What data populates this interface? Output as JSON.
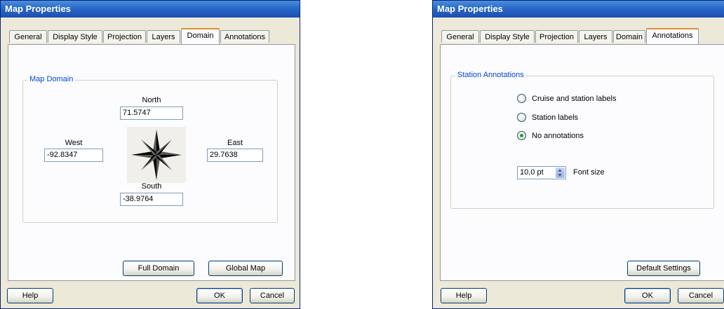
{
  "left_dialog": {
    "title": "Map Properties",
    "tabs": [
      "General",
      "Display Style",
      "Projection",
      "Layers",
      "Domain",
      "Annotations"
    ],
    "active_tab": "Domain",
    "group_title": "Map Domain",
    "north": {
      "label": "North",
      "value": "71.5747"
    },
    "west": {
      "label": "West",
      "value": "-92.8347"
    },
    "east": {
      "label": "East",
      "value": "29.7638"
    },
    "south": {
      "label": "South",
      "value": "-38.9764"
    },
    "full_domain_label": "Full Domain",
    "global_map_label": "Global Map",
    "help_label": "Help",
    "ok_label": "OK",
    "cancel_label": "Cancel"
  },
  "right_dialog": {
    "title": "Map Properties",
    "tabs": [
      "General",
      "Display Style",
      "Projection",
      "Layers",
      "Domain",
      "Annotations"
    ],
    "active_tab": "Annotations",
    "group_title": "Station Annotations",
    "options": [
      {
        "label": "Cruise and station labels",
        "selected": false
      },
      {
        "label": "Station labels",
        "selected": false
      },
      {
        "label": "No annotations",
        "selected": true
      }
    ],
    "font_size_value": "10,0 pt",
    "font_size_label": "Font size",
    "default_settings_label": "Default Settings",
    "help_label": "Help",
    "ok_label": "OK",
    "cancel_label": "Cancel"
  },
  "colors": {
    "title_bar": "#2968c8",
    "group_legend": "#0046d5",
    "active_tab_accent": "#e68b2c",
    "radio_selected": "#21a121"
  }
}
